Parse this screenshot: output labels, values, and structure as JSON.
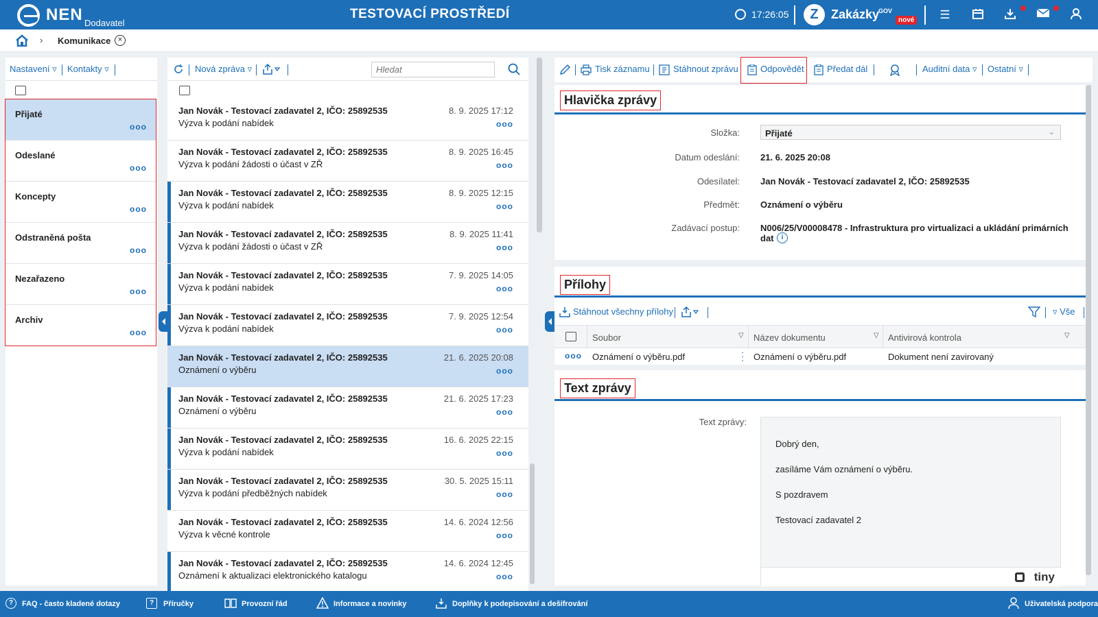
{
  "header": {
    "brand": "NEN",
    "brand_sub": "Dodavatel",
    "env_title": "TESTOVACÍ PROSTŘEDÍ",
    "time": "17:26:05",
    "zakazky": "Zakázky",
    "zakazky_gov": "GOV",
    "zakazky_badge": "nové"
  },
  "breadcrumb": {
    "current": "Komunikace"
  },
  "left": {
    "nastaveni": "Nastavení ▿",
    "kontakty": "Kontakty ▿",
    "folders": [
      {
        "name": "Přijaté",
        "selected": true
      },
      {
        "name": "Odeslané"
      },
      {
        "name": "Koncepty"
      },
      {
        "name": "Odstraněná pošta"
      },
      {
        "name": "Nezařazeno"
      },
      {
        "name": "Archiv"
      }
    ]
  },
  "middle": {
    "new_message": "Nová zpráva ▿",
    "search_placeholder": "Hledat",
    "messages": [
      {
        "from": "Jan Novák - Testovací zadavatel 2, IČO: 25892535",
        "subject": "Výzva k podání nabídek",
        "date": "8. 9. 2025 17:12",
        "bar": false
      },
      {
        "from": "Jan Novák - Testovací zadavatel 2, IČO: 25892535",
        "subject": "Výzva k podání žádosti o účast v ZŘ",
        "date": "8. 9. 2025 16:45",
        "bar": false
      },
      {
        "from": "Jan Novák - Testovací zadavatel 2, IČO: 25892535",
        "subject": "Výzva k podání nabídek",
        "date": "8. 9. 2025 12:15",
        "bar": true
      },
      {
        "from": "Jan Novák - Testovací zadavatel 2, IČO: 25892535",
        "subject": "Výzva k podání žádosti o účast v ZŘ",
        "date": "8. 9. 2025 11:41",
        "bar": true
      },
      {
        "from": "Jan Novák - Testovací zadavatel 2, IČO: 25892535",
        "subject": "Výzva k podání nabídek",
        "date": "7. 9. 2025 14:05",
        "bar": true
      },
      {
        "from": "Jan Novák - Testovací zadavatel 2, IČO: 25892535",
        "subject": "Výzva k podání nabídek",
        "date": "7. 9. 2025 12:54",
        "bar": true
      },
      {
        "from": "Jan Novák - Testovací zadavatel 2, IČO: 25892535",
        "subject": "Oznámení o výběru",
        "date": "21. 6. 2025 20:08",
        "bar": false,
        "selected": true
      },
      {
        "from": "Jan Novák - Testovací zadavatel 2, IČO: 25892535",
        "subject": "Oznámení o výběru",
        "date": "21. 6. 2025 17:23",
        "bar": true
      },
      {
        "from": "Jan Novák - Testovací zadavatel 2, IČO: 25892535",
        "subject": "Výzva k podání nabídek",
        "date": "16. 6. 2025 22:15",
        "bar": true
      },
      {
        "from": "Jan Novák - Testovací zadavatel 2, IČO: 25892535",
        "subject": "Výzva k podání předběžných nabídek",
        "date": "30. 5. 2025 15:11",
        "bar": true
      },
      {
        "from": "Jan Novák - Testovací zadavatel 2, IČO: 25892535",
        "subject": "Výzva k věcné kontrole",
        "date": "14. 6. 2024 12:56",
        "bar": false
      },
      {
        "from": "Jan Novák - Testovací zadavatel 2, IČO: 25892535",
        "subject": "Oznámení k aktualizaci elektronického katalogu",
        "date": "14. 6. 2024 12:45",
        "bar": true
      }
    ]
  },
  "right": {
    "toolbar": {
      "tisk": "Tisk záznamu",
      "stahnout": "Stáhnout zprávu",
      "odpovedet": "Odpovědět",
      "predat": "Předat dál",
      "auditni": "Auditní data ▿",
      "ostatni": "Ostatní ▿"
    },
    "header_title": "Hlavička zprávy",
    "fields": {
      "slozka_label": "Složka:",
      "slozka_value": "Přijaté",
      "datum_label": "Datum odeslání:",
      "datum_value": "21. 6. 2025 20:08",
      "odesilatel_label": "Odesílatel:",
      "odesilatel_value": "Jan Novák - Testovací zadavatel 2, IČO: 25892535",
      "predmet_label": "Předmět:",
      "predmet_value": "Oznámení o výběru",
      "postup_label": "Zadávací postup:",
      "postup_value_1": "N006/25/V00008478 - Infrastruktura pro virtualizaci a ukládání primárních",
      "postup_value_2": "dat"
    },
    "attachments_title": "Přílohy",
    "download_all": "Stáhnout všechny přílohy",
    "filter_all": "▿ Vše",
    "columns": {
      "soubor": "Soubor",
      "nazev": "Název dokumentu",
      "antivir": "Antivirová kontrola"
    },
    "attachment": {
      "soubor": "Oznámení o výběru.pdf",
      "nazev": "Oznámení o výběru.pdf",
      "antivir": "Dokument není zavirovaný"
    },
    "text_title": "Text zprávy",
    "text_label": "Text zprávy:",
    "text_lines": [
      "Dobrý den,",
      "zasíláme Vám oznámení o výběru.",
      "S pozdravem",
      "Testovací zadavatel 2"
    ],
    "tiny": "tiny"
  },
  "footer": {
    "faq": "FAQ - často kladené dotazy",
    "prirucky": "Příručky",
    "provozni": "Provozní řád",
    "informace": "Informace a novinky",
    "doplnky": "Doplňky k podepisování a dešifrování",
    "podpora": "Uživatelská podpora"
  }
}
